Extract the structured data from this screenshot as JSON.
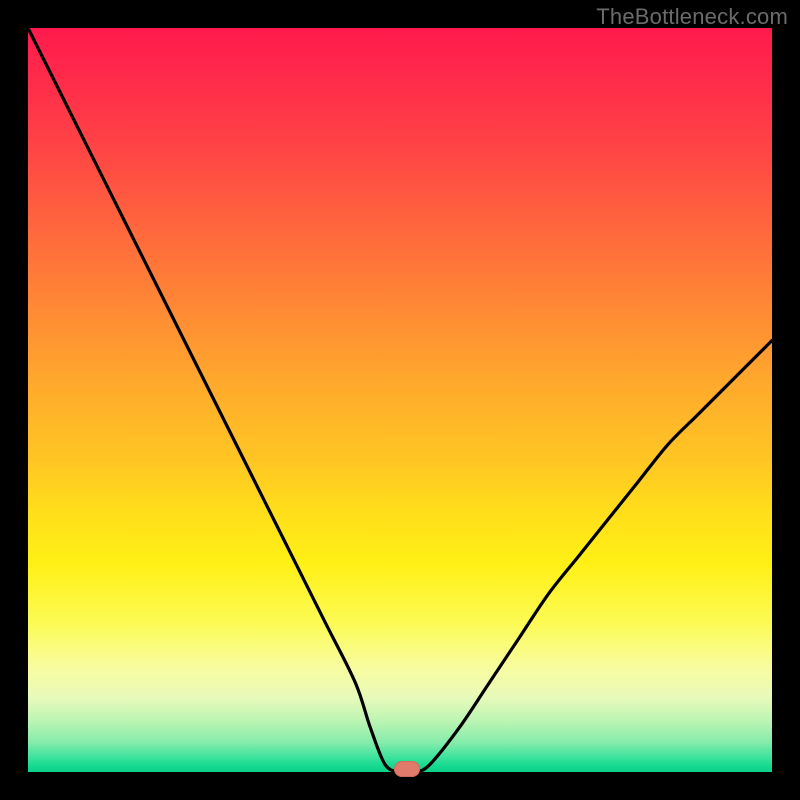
{
  "watermark": "TheBottleneck.com",
  "colors": {
    "background": "#000000",
    "gradient_top": "#ff1a4d",
    "gradient_bottom": "#0fd08a",
    "curve": "#000000",
    "marker": "#e07a6a"
  },
  "chart_data": {
    "type": "line",
    "title": "",
    "xlabel": "",
    "ylabel": "",
    "xlim": [
      0,
      100
    ],
    "ylim": [
      0,
      100
    ],
    "x": [
      0,
      4,
      8,
      12,
      16,
      20,
      24,
      28,
      32,
      36,
      40,
      44,
      46,
      48,
      50,
      52,
      54,
      58,
      62,
      66,
      70,
      74,
      78,
      82,
      86,
      90,
      94,
      98,
      100
    ],
    "values": [
      100,
      92,
      84,
      76,
      68,
      60,
      52,
      44,
      36,
      28,
      20,
      12,
      6,
      1,
      0,
      0,
      1,
      6,
      12,
      18,
      24,
      29,
      34,
      39,
      44,
      48,
      52,
      56,
      58
    ],
    "grid": false,
    "annotations": [
      {
        "type": "marker",
        "x": 51,
        "y": 0,
        "label": ""
      }
    ]
  }
}
